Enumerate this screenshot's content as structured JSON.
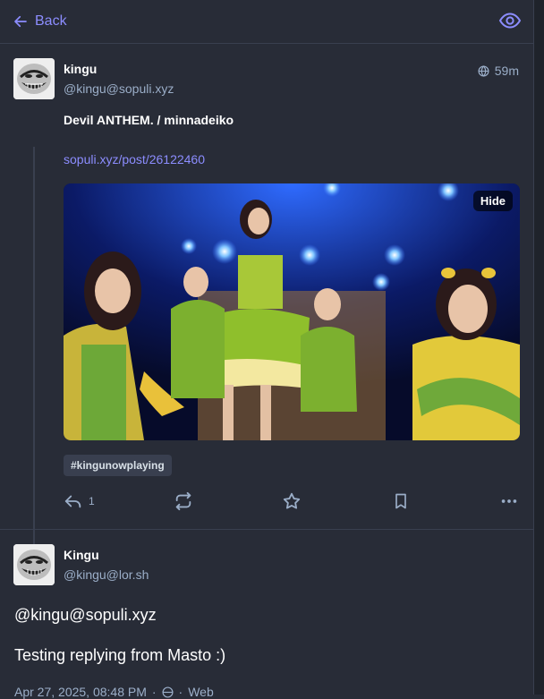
{
  "header": {
    "back_label": "Back",
    "eye_icon": "eye-icon"
  },
  "status": {
    "display_name": "kingu",
    "account": "@kingu@sopuli.xyz",
    "time": "59m",
    "title": "Devil ANTHEM. / minnadeiko",
    "link": "sopuli.xyz/post/26122460",
    "media": {
      "hide_label": "Hide"
    },
    "hashtag": "#kingunowplaying",
    "actions": {
      "reply_count": "1"
    }
  },
  "reply": {
    "display_name": "Kingu",
    "account": "@kingu@lor.sh",
    "mention": "@kingu@sopuli.xyz",
    "text": "Testing replying from Masto :)",
    "date": "Apr 27, 2025, 08:48 PM",
    "via": "Web"
  },
  "colors": {
    "background": "#282c37",
    "accent": "#8c8dff",
    "muted": "#9baec8",
    "divider": "#393f4f"
  }
}
